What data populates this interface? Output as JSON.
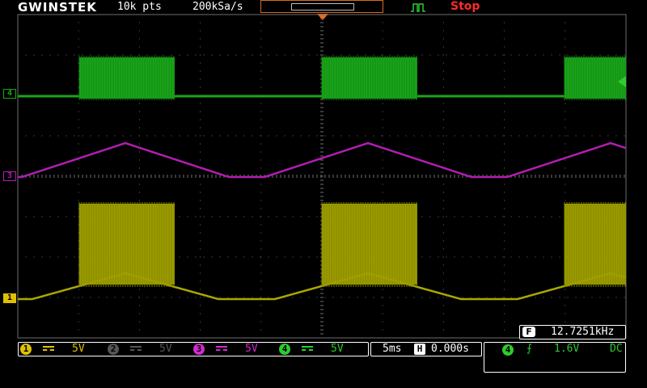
{
  "header": {
    "brand": "GWINSTEK",
    "record_length": "10k pts",
    "sample_rate": "200kSa/s",
    "run_state": "Stop"
  },
  "colors": {
    "ch1": "#a8a800",
    "ch2": "#555555",
    "ch3": "#b01eb0",
    "ch4": "#1aa51a",
    "trigger_marker": "#f06a1c",
    "stop_text": "#ff2a2a",
    "grid": "#6e6e6e"
  },
  "channel_markers": [
    {
      "id": "4",
      "name": "ch4-marker"
    },
    {
      "id": "3",
      "name": "ch3-marker"
    },
    {
      "id": "1",
      "name": "ch1-marker"
    }
  ],
  "frequency": {
    "label": "F",
    "value": "12.7251kHz"
  },
  "channels": [
    {
      "num": "1",
      "coupling_icon": "dc-coupling-icon",
      "scale": "5V",
      "active": true
    },
    {
      "num": "2",
      "coupling_icon": "dc-coupling-icon",
      "scale": "5V",
      "active": false
    },
    {
      "num": "3",
      "coupling_icon": "dc-coupling-icon",
      "scale": "5V",
      "active": true
    },
    {
      "num": "4",
      "coupling_icon": "dc-coupling-icon",
      "scale": "5V",
      "active": true
    }
  ],
  "timebase": {
    "scale": "5ms",
    "h_label": "H",
    "position": "0.000s"
  },
  "trigger": {
    "source": "4",
    "slope_icon": "rising-edge-icon",
    "slope": "⨍",
    "level": "1.6V",
    "coupling": "DC"
  }
}
